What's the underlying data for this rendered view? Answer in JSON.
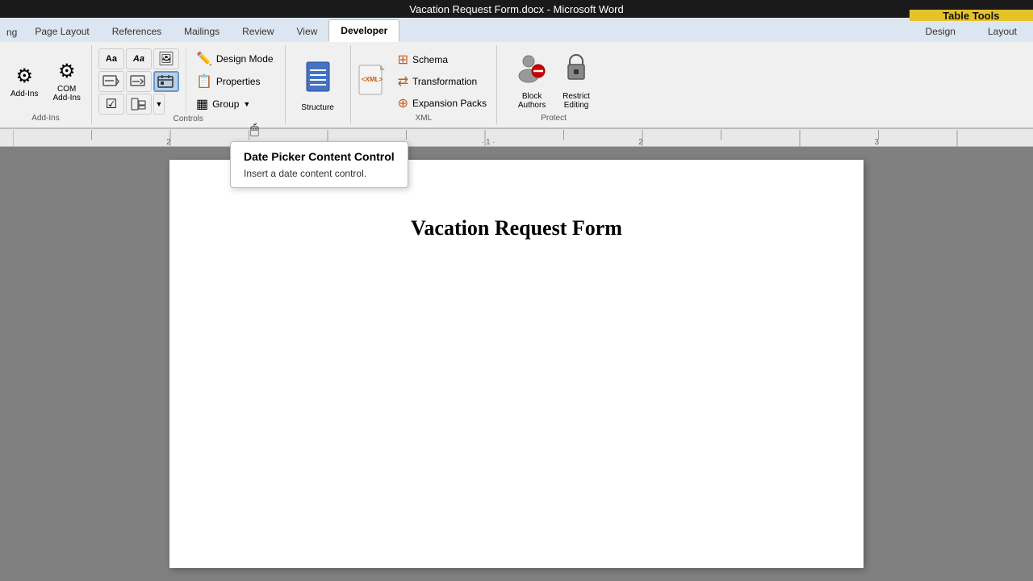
{
  "titleBar": {
    "text": "Vacation Request Form.docx - Microsoft Word"
  },
  "tableTools": {
    "label": "Table Tools"
  },
  "tabs": [
    {
      "id": "page-layout",
      "label": "Page Layout"
    },
    {
      "id": "references",
      "label": "References"
    },
    {
      "id": "mailings",
      "label": "Mailings"
    },
    {
      "id": "review",
      "label": "Review"
    },
    {
      "id": "view",
      "label": "View"
    },
    {
      "id": "developer",
      "label": "Developer",
      "active": true
    },
    {
      "id": "design",
      "label": "Design"
    },
    {
      "id": "layout",
      "label": "Layout"
    }
  ],
  "groups": {
    "addins": {
      "label": "Add-Ins",
      "items": [
        {
          "id": "addins",
          "label": "Add-Ins"
        },
        {
          "id": "com-addins",
          "label": "COM\nAdd-Ins"
        }
      ]
    },
    "controls": {
      "label": "Controls",
      "items": {
        "row1": [
          "Aa_rich",
          "Aa_plain",
          "picture"
        ],
        "row2": [
          "combo_box",
          "dropdown",
          "date_picker_active"
        ],
        "row3": [
          "checkbox",
          "legacy",
          "legacy2"
        ]
      },
      "buttons": [
        {
          "id": "design-mode",
          "label": "Design Mode"
        },
        {
          "id": "properties",
          "label": "Properties"
        },
        {
          "id": "group",
          "label": "Group"
        }
      ]
    },
    "xml": {
      "label": "XML",
      "items": [
        {
          "id": "schema",
          "label": "Schema"
        },
        {
          "id": "transformation",
          "label": "Transformation"
        },
        {
          "id": "expansion-packs",
          "label": "Expansion Packs"
        }
      ]
    },
    "structure": {
      "label": "",
      "button": "Structure"
    },
    "protect": {
      "label": "Protect",
      "items": [
        {
          "id": "block-authors",
          "label": "Block\nAuthors"
        },
        {
          "id": "restrict-editing",
          "label": "Restrict\nEditing"
        }
      ]
    }
  },
  "tooltip": {
    "title": "Date Picker Content Control",
    "body": "Insert a date content control."
  },
  "document": {
    "title": "Vacation Request Form"
  },
  "partialText": {
    "ng": "ng",
    "slash": "/"
  }
}
